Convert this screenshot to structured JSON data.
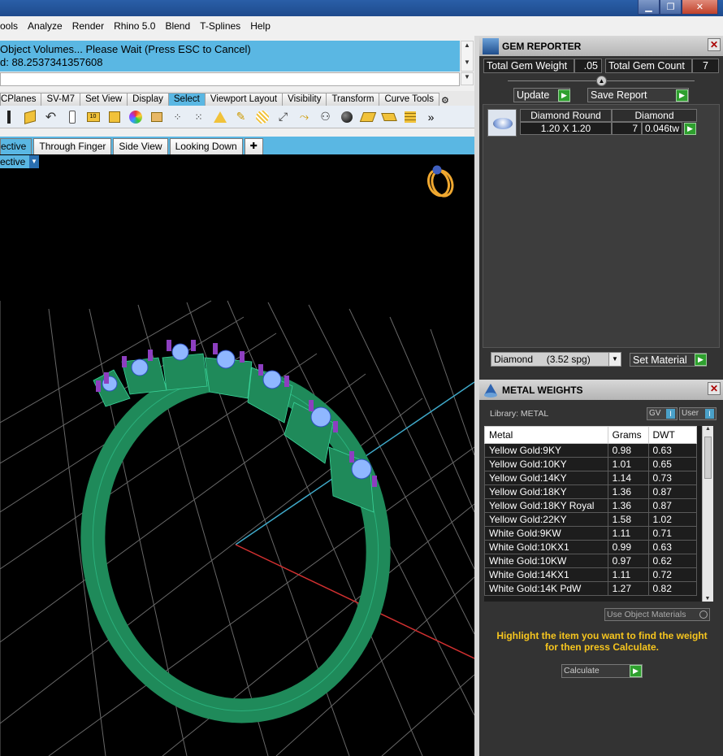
{
  "menubar": {
    "items": [
      "ools",
      "Analyze",
      "Render",
      "Rhino 5.0",
      "Blend",
      "T-Splines",
      "Help"
    ]
  },
  "command": {
    "line1": "Object Volumes... Please Wait (Press ESC to Cancel)",
    "line2": "d: 88.2537341357608"
  },
  "toolbar_tabs": [
    "CPlanes",
    "SV-M7",
    "Set View",
    "Display",
    "Select",
    "Viewport Layout",
    "Visibility",
    "Transform",
    "Curve Tools"
  ],
  "viewport_tabs": [
    "ective",
    "Through Finger",
    "Side View",
    "Looking Down"
  ],
  "viewport_label": "ective",
  "gem_reporter": {
    "title": "GEM REPORTER",
    "total_weight_label": "Total Gem Weight",
    "total_weight_value": ".05",
    "total_count_label": "Total Gem Count",
    "total_count_value": "7",
    "update_label": "Update",
    "save_label": "Save Report",
    "gem_name": "Diamond Round",
    "gem_size": "1.20 X 1.20",
    "material": "Diamond",
    "count": "7",
    "weight": "0.046tw",
    "material_select": "Diamond     (3.52 spg)",
    "set_material_label": "Set Material"
  },
  "metal_weights": {
    "title": "METAL WEIGHTS",
    "library_label": "Library: METAL",
    "gv_label": "GV",
    "user_label": "User",
    "columns": [
      "Metal",
      "Grams",
      "DWT"
    ],
    "rows": [
      [
        "Yellow Gold:9KY",
        "0.98",
        "0.63"
      ],
      [
        "Yellow Gold:10KY",
        "1.01",
        "0.65"
      ],
      [
        "Yellow Gold:14KY",
        "1.14",
        "0.73"
      ],
      [
        "Yellow Gold:18KY",
        "1.36",
        "0.87"
      ],
      [
        "Yellow Gold:18KY Royal",
        "1.36",
        "0.87"
      ],
      [
        "Yellow Gold:22KY",
        "1.58",
        "1.02"
      ],
      [
        "White Gold:9KW",
        "1.11",
        "0.71"
      ],
      [
        "White Gold:10KX1",
        "0.99",
        "0.63"
      ],
      [
        "White Gold:10KW",
        "0.97",
        "0.62"
      ],
      [
        "White Gold:14KX1",
        "1.11",
        "0.72"
      ],
      [
        "White Gold:14K PdW",
        "1.27",
        "0.82"
      ]
    ],
    "use_object_materials": "Use Object Materials",
    "hint": "Highlight the item you want to find the weight for then press Calculate.",
    "calculate_label": "Calculate"
  },
  "colors": {
    "accent_blue": "#5ab7e3",
    "ring_green": "#1f8a5a",
    "hint_yellow": "#f6c51e",
    "button_green": "#2ea02e"
  }
}
